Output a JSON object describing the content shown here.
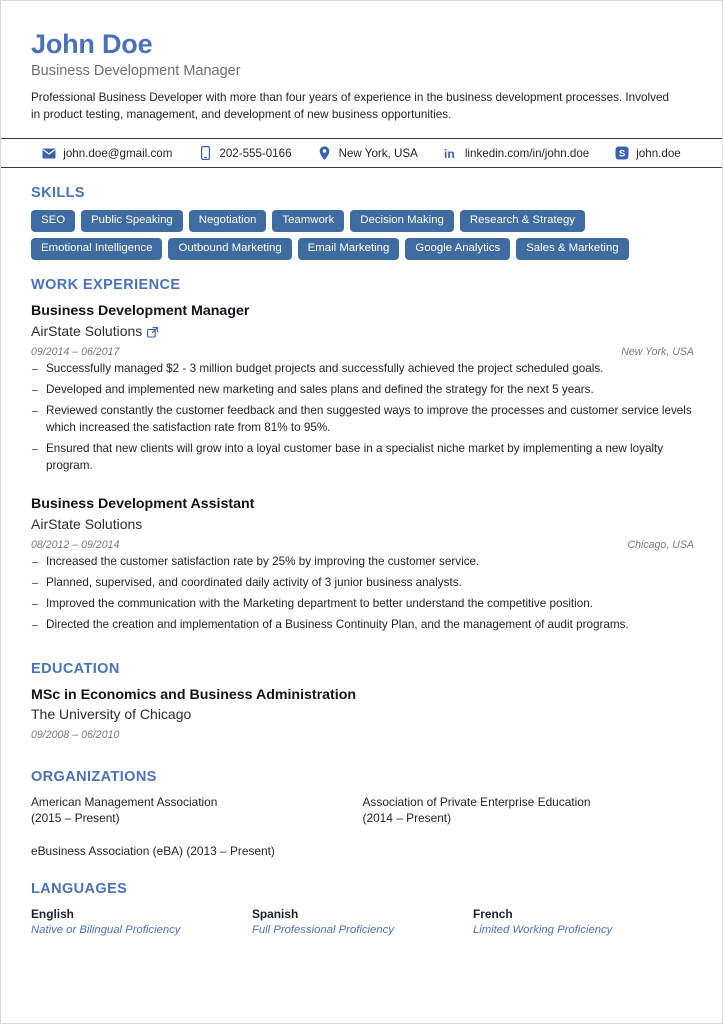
{
  "header": {
    "name": "John Doe",
    "job_title": "Business Development Manager",
    "summary": "Professional Business Developer with more than four years of experience in the business development processes. Involved in product testing, management, and development of new business opportunities."
  },
  "contact": [
    {
      "icon": "email-icon",
      "text": "john.doe@gmail.com"
    },
    {
      "icon": "phone-icon",
      "text": "202-555-0166"
    },
    {
      "icon": "location-pin-icon",
      "text": "New York, USA"
    },
    {
      "icon": "linkedin-icon",
      "text": "linkedin.com/in/john.doe"
    },
    {
      "icon": "skype-icon",
      "text": "john.doe"
    }
  ],
  "skills": {
    "title": "SKILLS",
    "rows": [
      [
        "SEO",
        "Public Speaking",
        "Negotiation",
        "Teamwork",
        "Decision Making",
        "Research & Strategy"
      ],
      [
        "Emotional Intelligence",
        "Outbound Marketing",
        "Email Marketing",
        "Google Analytics",
        "Sales & Marketing"
      ]
    ]
  },
  "work": {
    "title": "WORK EXPERIENCE",
    "jobs": [
      {
        "role": "Business Development Manager",
        "company": "AirState Solutions",
        "has_link": true,
        "dates": "09/2014 – 06/2017",
        "location": "New York, USA",
        "bullets": [
          "Successfully managed $2 - 3 million budget projects and successfully achieved the project scheduled goals.",
          "Developed and implemented new marketing and sales plans and defined the strategy for the next 5 years.",
          "Reviewed constantly the customer feedback and then suggested ways to improve the processes and customer service levels which increased the satisfaction rate from 81% to 95%.",
          "Ensured that new clients will grow into a loyal customer base in a specialist niche market by implementing a new loyalty program."
        ]
      },
      {
        "role": "Business Development Assistant",
        "company": "AirState Solutions",
        "has_link": false,
        "dates": "08/2012 – 09/2014",
        "location": "Chicago, USA",
        "bullets": [
          "Increased the customer satisfaction rate by 25% by improving the customer service.",
          "Planned, supervised, and coordinated daily activity of 3 junior business analysts.",
          "Improved the communication with the Marketing department to better understand the competitive position.",
          "Directed the creation and implementation of a Business Continuity Plan, and the management of audit programs."
        ]
      }
    ]
  },
  "education": {
    "title": "EDUCATION",
    "entries": [
      {
        "degree": "MSc in Economics and Business Administration",
        "school": "The University of Chicago",
        "dates": "09/2008 – 06/2010"
      }
    ]
  },
  "organizations": {
    "title": "ORGANIZATIONS",
    "items": [
      "American Management Association\n(2015 – Present)",
      "Association of Private Enterprise Education\n(2014 – Present)",
      "eBusiness Association (eBA) (2013 – Present)"
    ]
  },
  "languages": {
    "title": "LANGUAGES",
    "items": [
      {
        "name": "English",
        "level": "Native or Bilingual Proficiency"
      },
      {
        "name": "Spanish",
        "level": "Full Professional Proficiency"
      },
      {
        "name": "French",
        "level": "Limited Working Proficiency"
      }
    ]
  },
  "colors": {
    "accent_blue": "#4a72b8",
    "tag_blue": "#3f6ca0",
    "icon_blue": "#3a61b0",
    "rule_dark": "#3b3b3b",
    "text_gray": "#6f6f6f"
  }
}
